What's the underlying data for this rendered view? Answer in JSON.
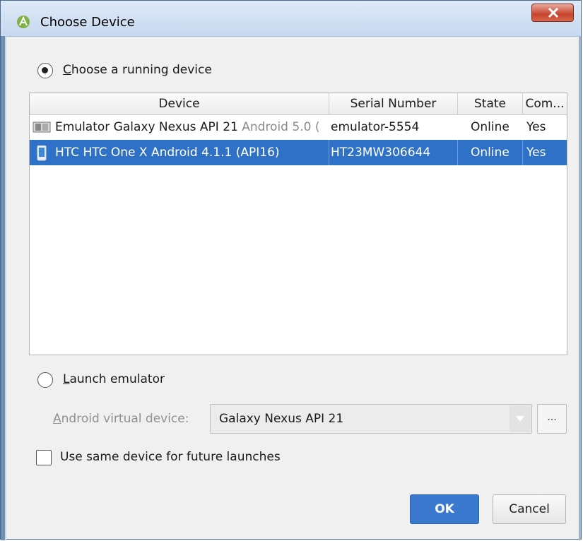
{
  "window": {
    "title": "Choose Device"
  },
  "running": {
    "label_first": "C",
    "label_rest": "hoose a running device",
    "selected": true
  },
  "table": {
    "columns": [
      "Device",
      "Serial Number",
      "State",
      "Com..."
    ],
    "rows": [
      {
        "device": "Emulator Galaxy Nexus API 21",
        "device_extra": "Android 5.0 (",
        "serial": "emulator-5554",
        "state": "Online",
        "compatible": "Yes",
        "icon": "emulator-icon",
        "selected": false
      },
      {
        "device": "HTC HTC One X Android 4.1.1 (API16)",
        "device_extra": "",
        "serial": "HT23MW306644",
        "state": "Online",
        "compatible": "Yes",
        "icon": "phone-icon",
        "selected": true
      }
    ]
  },
  "launch": {
    "label_first": "L",
    "label_rest": "aunch emulator",
    "selected": false
  },
  "avd": {
    "label_first": "A",
    "label_rest": "ndroid virtual device:",
    "value": "Galaxy Nexus API 21",
    "browse_label": "..."
  },
  "same_device": {
    "label": "Use same device for future launches",
    "checked": false
  },
  "buttons": {
    "ok": "OK",
    "cancel": "Cancel"
  },
  "colors": {
    "selection": "#2f71c6",
    "ok_button": "#3b79cf",
    "close_button": "#c5432b"
  }
}
